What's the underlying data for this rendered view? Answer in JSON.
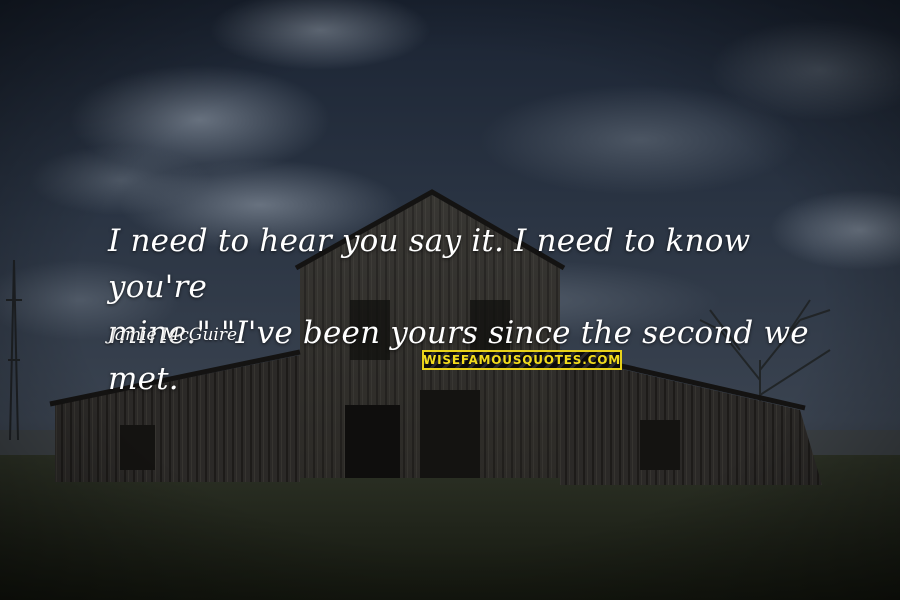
{
  "quote": {
    "line1": "I need to hear you say it. I need to know you're",
    "line2": "mine.\" \"I've been yours since the second we met."
  },
  "author": "Jamie McGuire",
  "watermark": "WISEFAMOUSQUOTES.COM",
  "colors": {
    "text": "#ffffff",
    "watermark_yellow": "#f3dc1d",
    "sky_dark": "#1c2430"
  }
}
